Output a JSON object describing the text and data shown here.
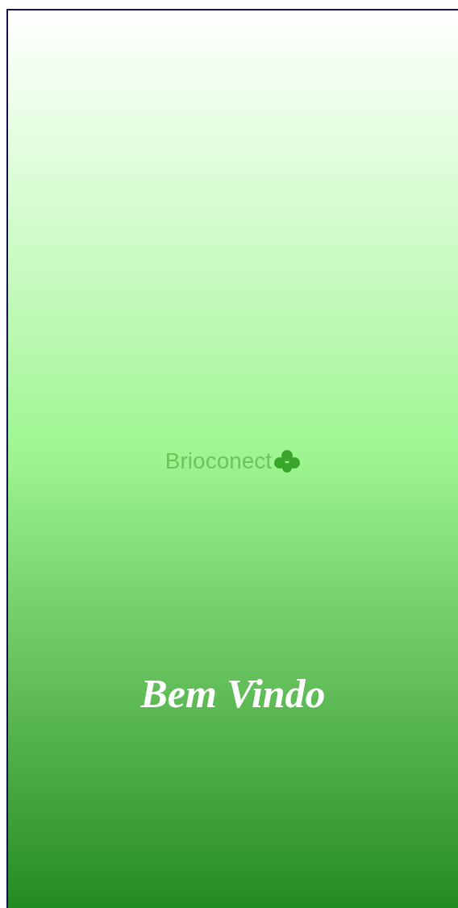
{
  "logo": {
    "text": "Brioconect"
  },
  "greeting": "Bem Vindo"
}
